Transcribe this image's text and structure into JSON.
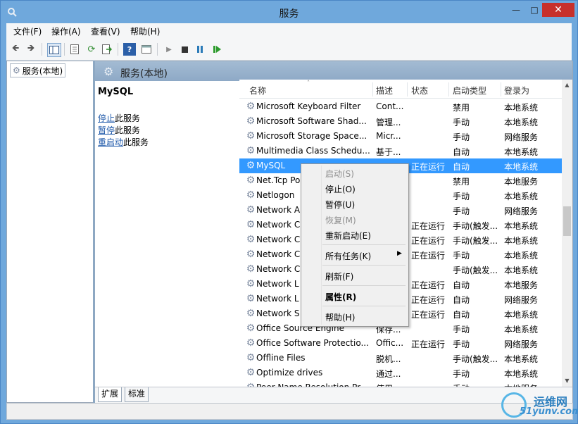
{
  "window": {
    "title": "服务",
    "controls": {
      "minimize": "—",
      "maximize": "□",
      "close": "✕"
    }
  },
  "menubar": [
    "文件(F)",
    "操作(A)",
    "查看(V)",
    "帮助(H)"
  ],
  "toolbar_icons": [
    "back-arrow-icon",
    "forward-arrow-icon",
    "console-tree-icon",
    "properties-icon",
    "refresh-icon",
    "export-icon",
    "help-icon",
    "view-icon",
    "play-icon",
    "stop-icon",
    "pause-icon",
    "resume-icon"
  ],
  "tree": {
    "root_label": "服务(本地)"
  },
  "header": {
    "title": "服务(本地)"
  },
  "detail": {
    "service_name": "MySQL",
    "actions": [
      {
        "link": "停止",
        "suffix": "此服务"
      },
      {
        "link": "暂停",
        "suffix": "此服务"
      },
      {
        "link": "重启动",
        "suffix": "此服务"
      }
    ]
  },
  "columns": [
    "名称",
    "描述",
    "状态",
    "启动类型",
    "登录为"
  ],
  "rows": [
    {
      "name": "Microsoft Keyboard Filter",
      "desc": "Cont...",
      "status": "",
      "startup": "禁用",
      "logon": "本地系统"
    },
    {
      "name": "Microsoft Software Shad...",
      "desc": "管理...",
      "status": "",
      "startup": "手动",
      "logon": "本地系统"
    },
    {
      "name": "Microsoft Storage Space...",
      "desc": "Micr...",
      "status": "",
      "startup": "手动",
      "logon": "网络服务"
    },
    {
      "name": "Multimedia Class Schedu...",
      "desc": "基于...",
      "status": "",
      "startup": "自动",
      "logon": "本地系统"
    },
    {
      "name": "MySQL",
      "desc": "",
      "status": "正在运行",
      "startup": "自动",
      "logon": "本地系统",
      "selected": true
    },
    {
      "name": "Net.Tcp Po",
      "desc": "",
      "status": "",
      "startup": "禁用",
      "logon": "本地服务"
    },
    {
      "name": "Netlogon",
      "desc": "",
      "status": "",
      "startup": "手动",
      "logon": "本地系统"
    },
    {
      "name": "Network A",
      "desc": "",
      "status": "",
      "startup": "手动",
      "logon": "网络服务"
    },
    {
      "name": "Network C",
      "desc": "",
      "status": "正在运行",
      "startup": "手动(触发...",
      "logon": "本地系统"
    },
    {
      "name": "Network C",
      "desc": "",
      "status": "正在运行",
      "startup": "手动(触发...",
      "logon": "本地系统"
    },
    {
      "name": "Network C",
      "desc": "",
      "status": "正在运行",
      "startup": "手动",
      "logon": "本地系统"
    },
    {
      "name": "Network C",
      "desc": "",
      "status": "",
      "startup": "手动(触发...",
      "logon": "本地系统"
    },
    {
      "name": "Network L",
      "desc": "",
      "status": "正在运行",
      "startup": "自动",
      "logon": "本地服务"
    },
    {
      "name": "Network L",
      "desc": "",
      "status": "正在运行",
      "startup": "自动",
      "logon": "网络服务"
    },
    {
      "name": "Network S",
      "desc": "",
      "status": "正在运行",
      "startup": "自动",
      "logon": "本地系统"
    },
    {
      "name": "Office  Source Engine",
      "desc": "保存...",
      "status": "",
      "startup": "手动",
      "logon": "本地系统"
    },
    {
      "name": "Office Software Protectio...",
      "desc": "Offic...",
      "status": "正在运行",
      "startup": "手动",
      "logon": "网络服务"
    },
    {
      "name": "Offline Files",
      "desc": "脱机...",
      "status": "",
      "startup": "手动(触发...",
      "logon": "本地系统"
    },
    {
      "name": "Optimize drives",
      "desc": "通过...",
      "status": "",
      "startup": "手动",
      "logon": "本地系统"
    },
    {
      "name": "Peer Name Resolution Pr...",
      "desc": "使用...",
      "status": "",
      "startup": "手动",
      "logon": "本地服务"
    }
  ],
  "context_menu": [
    {
      "label": "启动(S)",
      "disabled": true
    },
    {
      "label": "停止(O)"
    },
    {
      "label": "暂停(U)"
    },
    {
      "label": "恢复(M)",
      "disabled": true
    },
    {
      "label": "重新启动(E)"
    },
    {
      "label": "所有任务(K)",
      "submenu": true
    },
    {
      "label": "刷新(F)"
    },
    {
      "label": "属性(R)",
      "bold": true
    },
    {
      "label": "帮助(H)"
    }
  ],
  "tabs": [
    "扩展",
    "标准"
  ],
  "watermark": {
    "cn": "运维网",
    "en": "51yunv.com"
  }
}
